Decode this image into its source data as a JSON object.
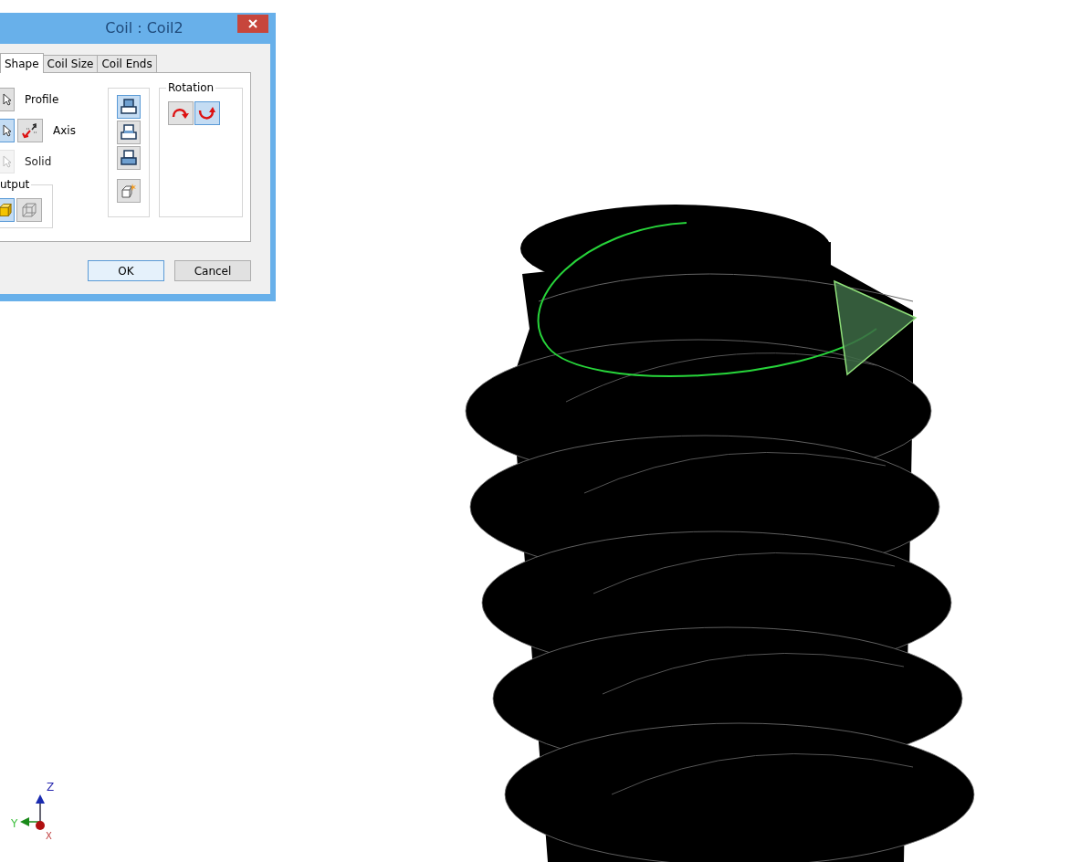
{
  "window": {
    "title": "Coil : Coil2"
  },
  "tabs": [
    {
      "label": "Shape",
      "selected": true
    },
    {
      "label": "Coil Size",
      "selected": false
    },
    {
      "label": "Coil Ends",
      "selected": false
    }
  ],
  "shape_rows": [
    {
      "label": "Profile",
      "selected": false,
      "disabled": false,
      "kind": "profile"
    },
    {
      "label": "Axis",
      "selected": true,
      "disabled": false,
      "kind": "axis"
    },
    {
      "label": "Solid",
      "selected": false,
      "disabled": true,
      "kind": "solid"
    }
  ],
  "output": {
    "label": "utput",
    "options": [
      {
        "kind": "solid",
        "selected": true
      },
      {
        "kind": "surface",
        "selected": false
      }
    ]
  },
  "methods": [
    {
      "kind": "top",
      "selected": true
    },
    {
      "kind": "middle",
      "selected": false
    },
    {
      "kind": "bottom",
      "selected": false
    },
    {
      "kind": "optimize",
      "selected": false
    }
  ],
  "rotation": {
    "label": "Rotation",
    "options": [
      {
        "kind": "clockwise",
        "selected": false
      },
      {
        "kind": "counterclockwise",
        "selected": true
      }
    ]
  },
  "buttons": [
    {
      "label": "OK",
      "default": true
    },
    {
      "label": "Cancel",
      "default": false
    }
  ],
  "triad": {
    "z": "Z",
    "y": "Y",
    "x": "X"
  }
}
